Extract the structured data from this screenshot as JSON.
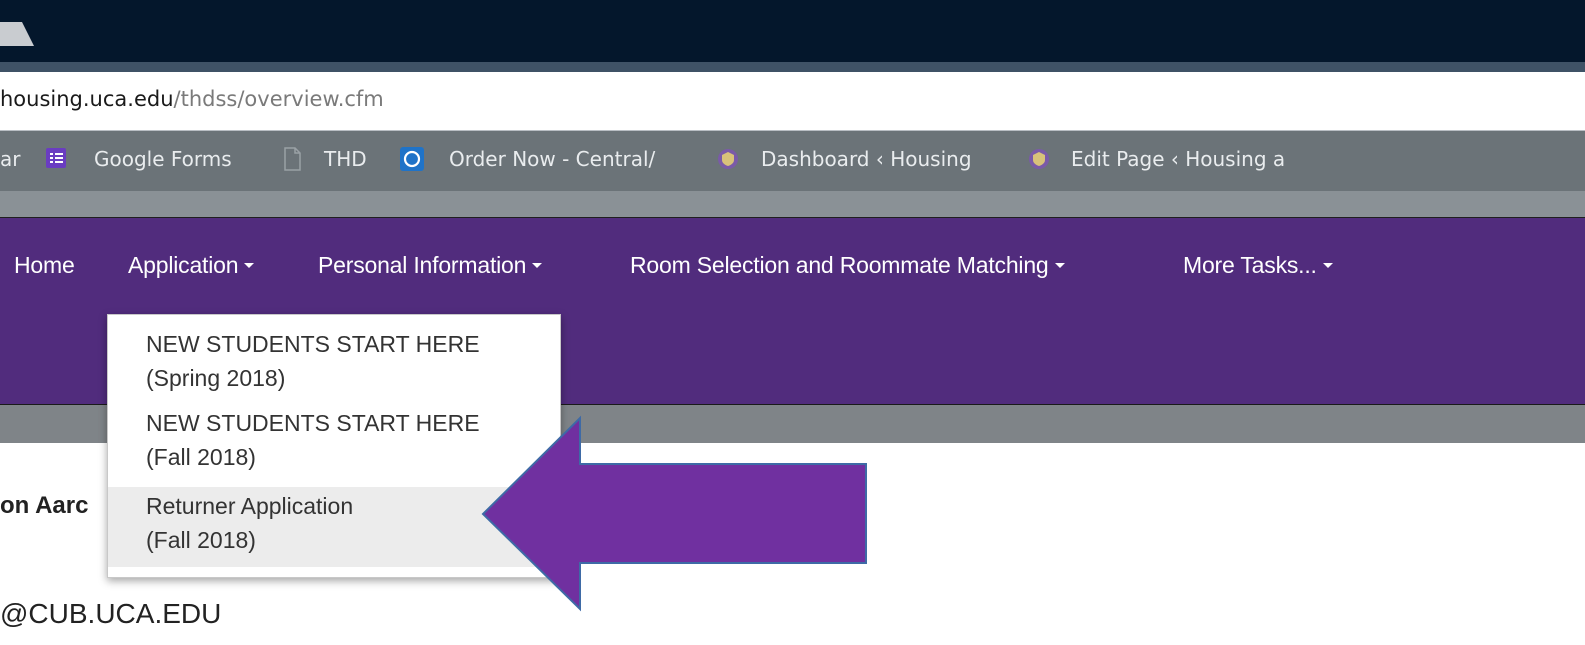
{
  "browser": {
    "url_domain": "housing.uca.edu",
    "url_path": "/thdss/overview.cfm",
    "bookmarks": [
      {
        "label": "ar",
        "icon": "",
        "dim": false
      },
      {
        "label": "Google Forms",
        "icon": "google-forms-icon",
        "dim": false
      },
      {
        "label": "THD",
        "icon": "page-icon",
        "dim": false
      },
      {
        "label": "Order Now - Central/",
        "icon": "circle-app-icon",
        "dim": false
      },
      {
        "label": "Dashboard ‹ Housing",
        "icon": "shield-icon",
        "dim": false
      },
      {
        "label": "Edit Page ‹ Housing a",
        "icon": "shield-icon",
        "dim": false
      }
    ]
  },
  "nav": {
    "items": [
      {
        "label": "Home",
        "has_caret": false
      },
      {
        "label": "Application",
        "has_caret": true
      },
      {
        "label": "Personal Information",
        "has_caret": true
      },
      {
        "label": "Room Selection and Roommate Matching",
        "has_caret": true
      },
      {
        "label": "More Tasks...",
        "has_caret": true
      }
    ]
  },
  "dropdown": {
    "items": [
      {
        "line1": "NEW STUDENTS START HERE",
        "line2": "(Spring 2018)",
        "active": false
      },
      {
        "line1": "NEW STUDENTS START HERE",
        "line2": "(Fall 2018)",
        "active": false
      },
      {
        "line1": "Returner Application",
        "line2": "(Fall 2018)",
        "active": true
      }
    ]
  },
  "content": {
    "name_fragment": "on Aarc",
    "email_fragment": "@CUB.UCA.EDU"
  },
  "colors": {
    "navbar": "#512c7d",
    "arrow": "#7030a0",
    "titlebar": "#04172c"
  }
}
